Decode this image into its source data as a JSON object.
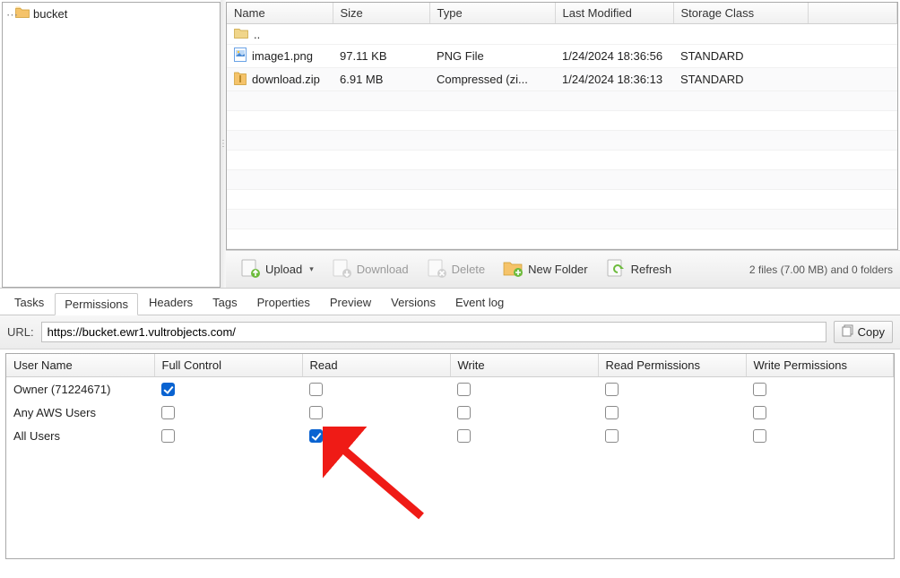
{
  "tree": {
    "bucket_label": "bucket"
  },
  "columns": {
    "name": "Name",
    "size": "Size",
    "type": "Type",
    "modified": "Last Modified",
    "storage": "Storage Class"
  },
  "parent_row": "..",
  "files": [
    {
      "name": "image1.png",
      "size": "97.11 KB",
      "type": "PNG File",
      "modified": "1/24/2024 18:36:56",
      "storage": "STANDARD",
      "icon": "image"
    },
    {
      "name": "download.zip",
      "size": "6.91 MB",
      "type": "Compressed (zi...",
      "modified": "1/24/2024 18:36:13",
      "storage": "STANDARD",
      "icon": "zip"
    }
  ],
  "toolbar": {
    "upload": "Upload",
    "download": "Download",
    "delete": "Delete",
    "newfolder": "New Folder",
    "refresh": "Refresh",
    "status": "2 files (7.00 MB) and 0 folders"
  },
  "tabs": {
    "tasks": "Tasks",
    "permissions": "Permissions",
    "headers": "Headers",
    "tags": "Tags",
    "properties": "Properties",
    "preview": "Preview",
    "versions": "Versions",
    "eventlog": "Event log"
  },
  "url": {
    "label": "URL:",
    "value": "https://bucket.ewr1.vultrobjects.com/",
    "copy": "Copy"
  },
  "perm_columns": {
    "user": "User Name",
    "full": "Full Control",
    "read": "Read",
    "write": "Write",
    "readp": "Read Permissions",
    "writep": "Write Permissions"
  },
  "perm_rows": [
    {
      "user": "Owner (71224671)",
      "full": true,
      "read": false,
      "write": false,
      "readp": false,
      "writep": false
    },
    {
      "user": "Any AWS Users",
      "full": false,
      "read": false,
      "write": false,
      "readp": false,
      "writep": false
    },
    {
      "user": "All Users",
      "full": false,
      "read": true,
      "write": false,
      "readp": false,
      "writep": false
    }
  ]
}
